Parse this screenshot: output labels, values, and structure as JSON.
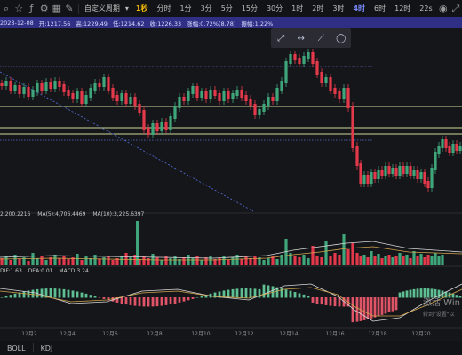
{
  "toolbar": {
    "chart_type_label": "自定义周期",
    "timeframes": [
      "1秒",
      "分时",
      "1分",
      "3分",
      "5分",
      "15分",
      "30分",
      "1时",
      "2时",
      "3时",
      "4时",
      "6时",
      "12时"
    ],
    "active_timeframe": "1秒",
    "selected_timeframe": "4时",
    "right_item": "22s"
  },
  "infobar": {
    "date": "2023-12-08",
    "open": "开:1217.56",
    "high": "高:1229.49",
    "low": "低:1214.62",
    "close": "收:1226.33",
    "change": "涨幅:0.72%(8.78)",
    "amplitude": "振幅:1.22%"
  },
  "volume": {
    "vol": "2,200.2216",
    "ma5": "MA(5):4,706.4469",
    "ma10": "MA(10):3,225.6397"
  },
  "macd": {
    "dif": "DIF:1.63",
    "dea": "DEA:0.01",
    "macd": "MACD:3.24"
  },
  "x_axis": [
    "12月2",
    "12月4",
    "12月6",
    "12月8",
    "12月10",
    "12月12",
    "12月14",
    "12月16",
    "12月18",
    "12月20"
  ],
  "bottom_tabs": [
    "BOLL",
    "KDJ"
  ],
  "watermark": {
    "line1": "激活 Win",
    "line2": "转到\"设置\"以"
  },
  "colors": {
    "up": "#3fa57a",
    "down": "#e3394b",
    "infobar_bg": "#2f2f86",
    "accent": "#f0b90b"
  },
  "icons": [
    "star-icon",
    "indicator-icon",
    "settings-icon",
    "grid-icon",
    "chart-style-icon",
    "drawing-icon",
    "camera-icon",
    "fullscreen-icon"
  ]
}
